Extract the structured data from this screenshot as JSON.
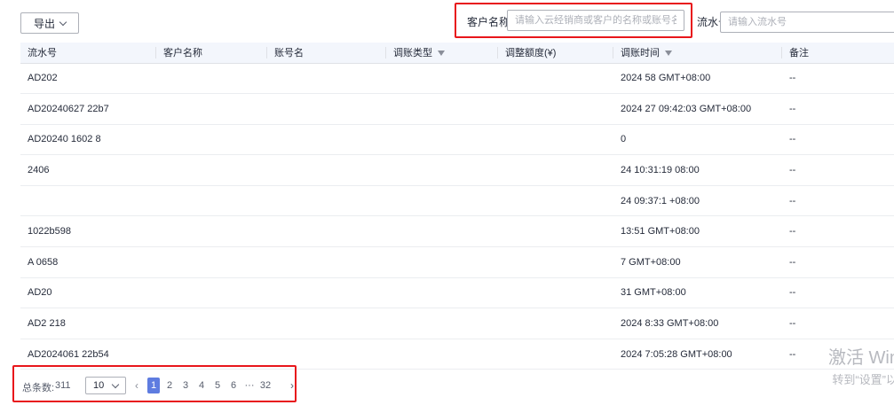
{
  "toolbar": {
    "export_label": "导出"
  },
  "filters": {
    "customer_label": "客户名称",
    "customer_placeholder": "请输入云经销商或客户的名称或账号名",
    "serial_label": "流水号",
    "serial_placeholder": "请输入流水号"
  },
  "table": {
    "columns": [
      "流水号",
      "客户名称",
      "账号名",
      "调账类型",
      "调整额度(¥)",
      "调账时间",
      "备注"
    ],
    "rows": [
      {
        "serial": "AD202",
        "customer": "",
        "account": "",
        "type": "",
        "amount": "",
        "time": "2024 58 GMT+08:00",
        "remark": "--"
      },
      {
        "serial": "AD20240627 22b7",
        "customer": "",
        "account": "",
        "type": "",
        "amount": "",
        "time": "2024 27 09:42:03 GMT+08:00",
        "remark": "--"
      },
      {
        "serial": "AD20240 1602 8",
        "customer": "",
        "account": "",
        "type": "",
        "amount": "",
        "time": "0",
        "remark": "--"
      },
      {
        "serial": "2406",
        "customer": "",
        "account": "",
        "type": "",
        "amount": "",
        "time": "24 10:31:19 08:00",
        "remark": "--"
      },
      {
        "serial": "",
        "customer": "",
        "account": "",
        "type": "",
        "amount": "",
        "time": "24 09:37:1 +08:00",
        "remark": "--"
      },
      {
        "serial": "1022b598",
        "customer": "",
        "account": "",
        "type": "",
        "amount": "",
        "time": "13:51 GMT+08:00",
        "remark": "--"
      },
      {
        "serial": "A 0658",
        "customer": "",
        "account": "",
        "type": "",
        "amount": "",
        "time": "7 GMT+08:00",
        "remark": "--"
      },
      {
        "serial": "AD20",
        "customer": "",
        "account": "",
        "type": "",
        "amount": "",
        "time": "31 GMT+08:00",
        "remark": "--"
      },
      {
        "serial": "AD2 218",
        "customer": "",
        "account": "",
        "type": "",
        "amount": "",
        "time": "2024 8:33 GMT+08:00",
        "remark": "--"
      },
      {
        "serial": "AD2024061 22b54",
        "customer": "",
        "account": "",
        "type": "",
        "amount": "",
        "time": "2024 7:05:28 GMT+08:00",
        "remark": "--"
      }
    ]
  },
  "pagination": {
    "total_label": "总条数:",
    "total_value": "311",
    "page_size": "10",
    "pages": [
      "1",
      "2",
      "3",
      "4",
      "5",
      "6",
      "···",
      "32"
    ],
    "active_page": "1"
  },
  "watermark": {
    "title": "激活 Win",
    "subtitle": "转到“设置”以"
  }
}
